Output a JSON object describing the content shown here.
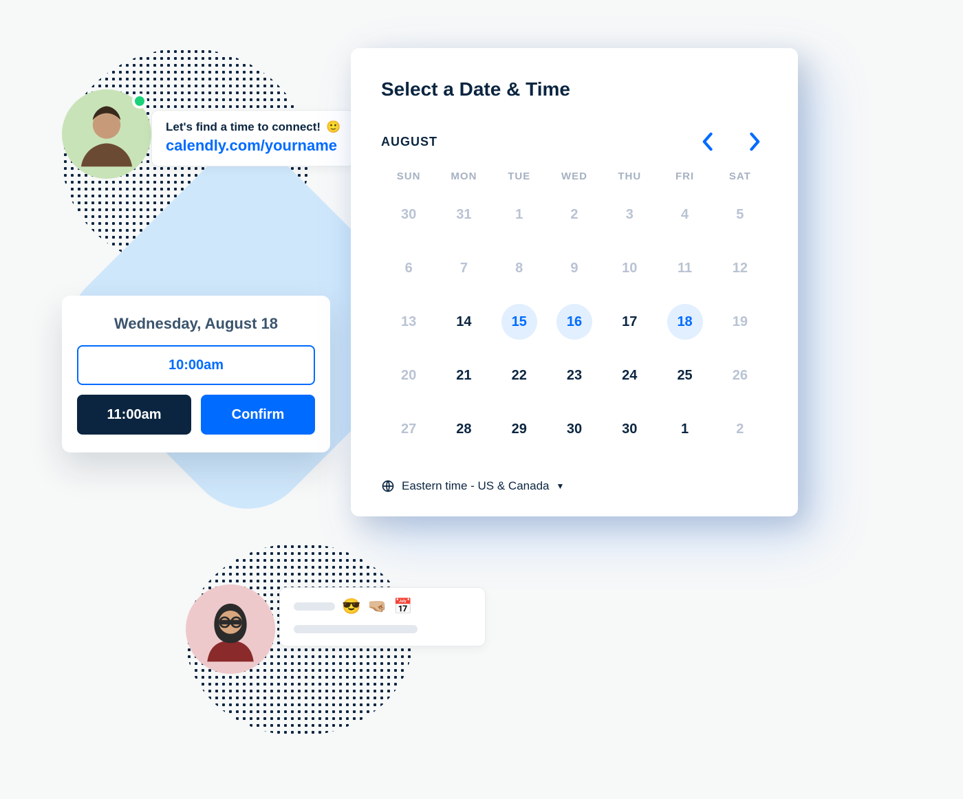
{
  "chat": {
    "prompt": "Let's find a time to connect!",
    "emoji": "🙂",
    "link": "calendly.com/yourname"
  },
  "reply": {
    "emojis": "😎 🤜🏼 📅"
  },
  "time_card": {
    "title": "Wednesday, August 18",
    "slot_open": "10:00am",
    "slot_selected": "11:00am",
    "confirm": "Confirm"
  },
  "calendar": {
    "title": "Select a Date & Time",
    "month": "AUGUST",
    "dow": [
      "SUN",
      "MON",
      "TUE",
      "WED",
      "THU",
      "FRI",
      "SAT"
    ],
    "weeks": [
      [
        {
          "d": "30",
          "muted": true
        },
        {
          "d": "31",
          "muted": true
        },
        {
          "d": "1",
          "muted": true
        },
        {
          "d": "2",
          "muted": true
        },
        {
          "d": "3",
          "muted": true
        },
        {
          "d": "4",
          "muted": true
        },
        {
          "d": "5",
          "muted": true
        }
      ],
      [
        {
          "d": "6",
          "muted": true
        },
        {
          "d": "7",
          "muted": true
        },
        {
          "d": "8",
          "muted": true
        },
        {
          "d": "9",
          "muted": true
        },
        {
          "d": "10",
          "muted": true
        },
        {
          "d": "11",
          "muted": true
        },
        {
          "d": "12",
          "muted": true
        }
      ],
      [
        {
          "d": "13",
          "muted": true
        },
        {
          "d": "14"
        },
        {
          "d": "15",
          "avail": true
        },
        {
          "d": "16",
          "avail": true
        },
        {
          "d": "17"
        },
        {
          "d": "18",
          "avail": true
        },
        {
          "d": "19",
          "muted": true
        }
      ],
      [
        {
          "d": "20",
          "muted": true
        },
        {
          "d": "21"
        },
        {
          "d": "22"
        },
        {
          "d": "23"
        },
        {
          "d": "24"
        },
        {
          "d": "25"
        },
        {
          "d": "26",
          "muted": true
        }
      ],
      [
        {
          "d": "27",
          "muted": true
        },
        {
          "d": "28"
        },
        {
          "d": "29"
        },
        {
          "d": "30"
        },
        {
          "d": "30"
        },
        {
          "d": "1"
        },
        {
          "d": "2",
          "muted": true
        }
      ]
    ],
    "timezone": "Eastern time - US & Canada"
  }
}
